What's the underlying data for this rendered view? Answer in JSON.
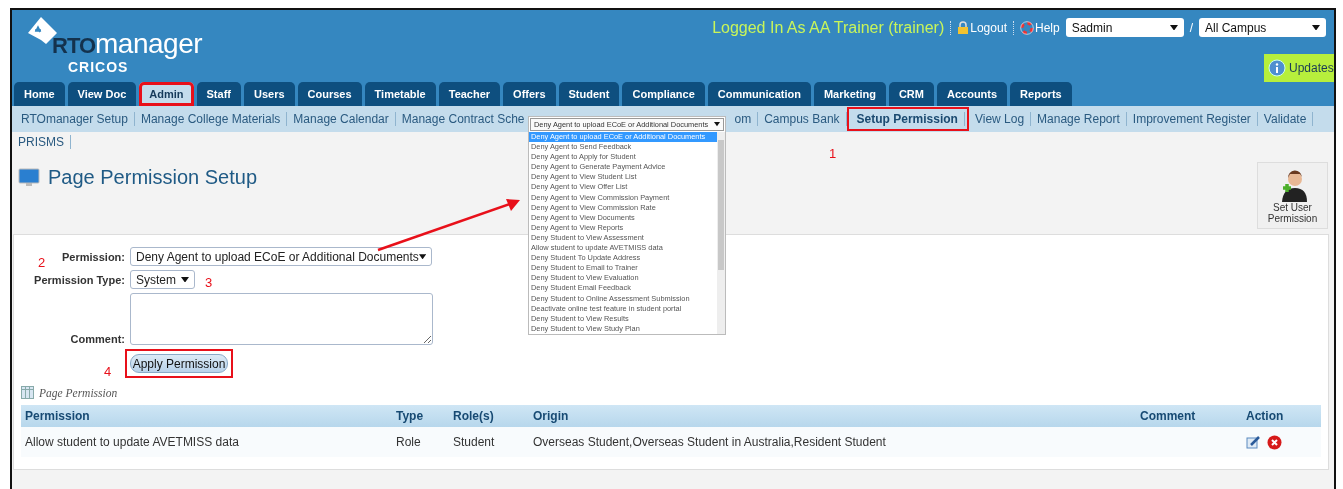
{
  "header": {
    "logo": {
      "bold": "RTO",
      "rest": "manager",
      "sub": "CRICOS"
    },
    "logged_in": "Logged In As  AA Trainer (trainer)",
    "links": [
      {
        "kind": "lock",
        "label": "Logout"
      },
      {
        "kind": "help",
        "label": "Help"
      }
    ],
    "user_select": "Sadmin",
    "separator": "/",
    "campus_select": "All Campus",
    "updates": "Updates"
  },
  "tabs": [
    {
      "label": "Home",
      "selected": false,
      "annotated": false
    },
    {
      "label": "View Doc",
      "selected": false,
      "annotated": false
    },
    {
      "label": "Admin",
      "selected": true,
      "annotated": true
    },
    {
      "label": "Staff",
      "selected": false,
      "annotated": false
    },
    {
      "label": "Users",
      "selected": false,
      "annotated": false
    },
    {
      "label": "Courses",
      "selected": false,
      "annotated": false
    },
    {
      "label": "Timetable",
      "selected": false,
      "annotated": false
    },
    {
      "label": "Teacher",
      "selected": false,
      "annotated": false
    },
    {
      "label": "Offers",
      "selected": false,
      "annotated": false
    },
    {
      "label": "Student",
      "selected": false,
      "annotated": false
    },
    {
      "label": "Compliance",
      "selected": false,
      "annotated": false
    },
    {
      "label": "Communication",
      "selected": false,
      "annotated": false
    },
    {
      "label": "Marketing",
      "selected": false,
      "annotated": false
    },
    {
      "label": "CRM",
      "selected": false,
      "annotated": false
    },
    {
      "label": "Accounts",
      "selected": false,
      "annotated": false
    },
    {
      "label": "Reports",
      "selected": false,
      "annotated": false
    }
  ],
  "submenu": [
    {
      "label": "RTOmanager Setup",
      "selected": false,
      "annotated": false
    },
    {
      "label": "Manage College Materials",
      "selected": false,
      "annotated": false
    },
    {
      "label": "Manage Calendar",
      "selected": false,
      "annotated": false
    },
    {
      "label": "Manage Contract Sche",
      "selected": false,
      "annotated": false,
      "kind": "covered"
    },
    {
      "label": "om",
      "selected": false,
      "annotated": false,
      "kind": "covered"
    },
    {
      "label": "Campus Bank",
      "selected": false,
      "annotated": false
    },
    {
      "label": "Setup Permission",
      "selected": true,
      "annotated": true
    },
    {
      "label": "View Log",
      "selected": false,
      "annotated": false
    },
    {
      "label": "Manage Report",
      "selected": false,
      "annotated": false
    },
    {
      "label": "Improvement Register",
      "selected": false,
      "annotated": false
    },
    {
      "label": "Validate",
      "selected": false,
      "annotated": false
    },
    {
      "label": "PRISMS",
      "selected": false,
      "annotated": false
    }
  ],
  "page_title": "Page Permission Setup",
  "set_user_permission": "Set User Permission",
  "form": {
    "permission_label": "Permission:",
    "permission_value": "Deny Agent to upload ECoE or Additional Documents",
    "type_label": "Permission Type:",
    "type_value": "System",
    "comment_label": "Comment:",
    "apply_button": "Apply Permission",
    "apply_annotated": true
  },
  "permission_dropdown": {
    "value": "Deny Agent to upload ECoE or Additional Documents",
    "options": [
      {
        "label": "Deny Agent to upload ECoE or Additional Documents",
        "selected": true
      },
      {
        "label": "Deny Agent to Send Feedback",
        "selected": false
      },
      {
        "label": "Deny Agent to Apply for Student",
        "selected": false
      },
      {
        "label": "Deny Agent to Generate Payment Advice",
        "selected": false
      },
      {
        "label": "Deny Agent to View Student List",
        "selected": false
      },
      {
        "label": "Deny Agent to View Offer List",
        "selected": false
      },
      {
        "label": "Deny Agent to View Commission Payment",
        "selected": false
      },
      {
        "label": "Deny Agent to View Commission Rate",
        "selected": false
      },
      {
        "label": "Deny Agent to View Documents",
        "selected": false
      },
      {
        "label": "Deny Agent to View Reports",
        "selected": false
      },
      {
        "label": "Deny Student to View Assessment",
        "selected": false
      },
      {
        "label": "Allow student to update AVETMISS data",
        "selected": false
      },
      {
        "label": "Deny Student To Update Address",
        "selected": false
      },
      {
        "label": "Deny Student to Email to Trainer",
        "selected": false
      },
      {
        "label": "Deny Student to View Evaluation",
        "selected": false
      },
      {
        "label": "Deny Student Email Feedback",
        "selected": false
      },
      {
        "label": "Deny Student to Online Assessment Submission",
        "selected": false
      },
      {
        "label": "Deactivate online test feature in student portal",
        "selected": false
      },
      {
        "label": "Deny Student to View Results",
        "selected": false
      },
      {
        "label": "Deny Student to View Study Plan",
        "selected": false
      }
    ]
  },
  "table": {
    "caption": "Page Permission",
    "columns": [
      "Permission",
      "Type",
      "Role(s)",
      "Origin",
      "Comment",
      "Action"
    ],
    "rows": [
      {
        "cells": [
          "Allow student to update AVETMISS data",
          "Role",
          "Student",
          "Overseas Student,Overseas Student in Australia,Resident Student",
          ""
        ]
      }
    ]
  },
  "annotations": [
    {
      "label": "1"
    },
    {
      "label": "2"
    },
    {
      "label": "3"
    },
    {
      "label": "4"
    }
  ]
}
